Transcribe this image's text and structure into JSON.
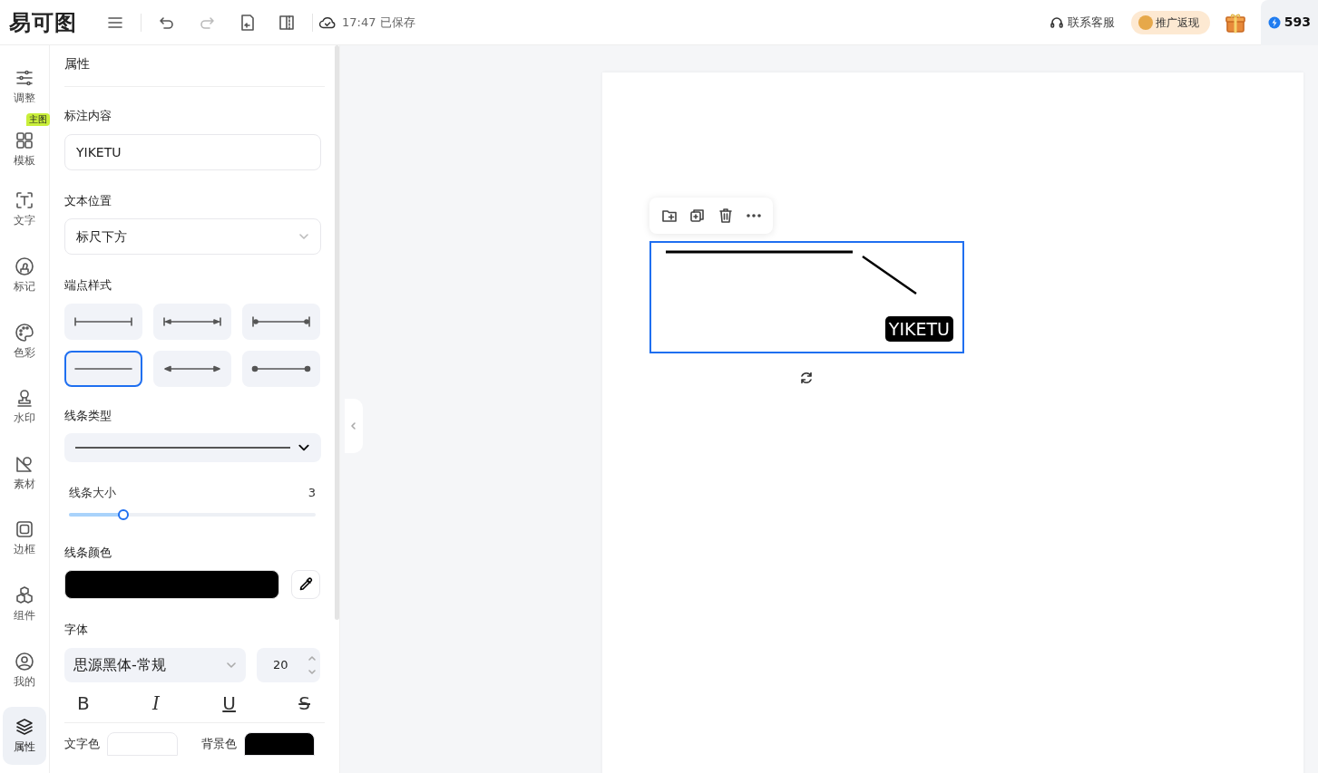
{
  "header": {
    "logo": "易可图",
    "saved_status": "17:47 已保存",
    "support": "联系客服",
    "promo": "推广返现",
    "credits": "593"
  },
  "sidebar": {
    "items": [
      {
        "label": "调整",
        "selected": false
      },
      {
        "label": "模板",
        "selected": false,
        "badge": "主图"
      },
      {
        "label": "文字",
        "selected": false
      },
      {
        "label": "标记",
        "selected": false
      },
      {
        "label": "色彩",
        "selected": false
      },
      {
        "label": "水印",
        "selected": false
      },
      {
        "label": "素材",
        "selected": false
      },
      {
        "label": "边框",
        "selected": false
      },
      {
        "label": "组件",
        "selected": false
      },
      {
        "label": "我的",
        "selected": false
      },
      {
        "label": "属性",
        "selected": true
      }
    ]
  },
  "panel": {
    "title": "属性",
    "annotation_content": {
      "label": "标注内容",
      "value": "YIKETU"
    },
    "text_position": {
      "label": "文本位置",
      "value": "标尺下方"
    },
    "endpoint_style": {
      "label": "端点样式",
      "options": [
        {
          "kind": "bar",
          "selected": false
        },
        {
          "kind": "bar-arrow",
          "selected": false
        },
        {
          "kind": "bar-dot",
          "selected": false
        },
        {
          "kind": "plain",
          "selected": true
        },
        {
          "kind": "arrow",
          "selected": false
        },
        {
          "kind": "dot",
          "selected": false
        }
      ]
    },
    "line_type": {
      "label": "线条类型"
    },
    "line_size": {
      "label": "线条大小",
      "value": "3",
      "level": 0.22
    },
    "line_color": {
      "label": "线条颜色",
      "color": "#000000"
    },
    "font": {
      "label": "字体",
      "family": "思源黑体-常规",
      "size": "20"
    },
    "text_styles": [
      {
        "kind": "bold",
        "label": "B"
      },
      {
        "kind": "italic",
        "label": "I"
      },
      {
        "kind": "underline",
        "label": "U"
      },
      {
        "kind": "strike",
        "label": "S"
      }
    ],
    "text_color": {
      "label": "文字色",
      "color": "#ffffff"
    },
    "background_color": {
      "label": "背景色",
      "color": "#000000"
    }
  },
  "canvas": {
    "annotation_text": "YIKETU"
  }
}
